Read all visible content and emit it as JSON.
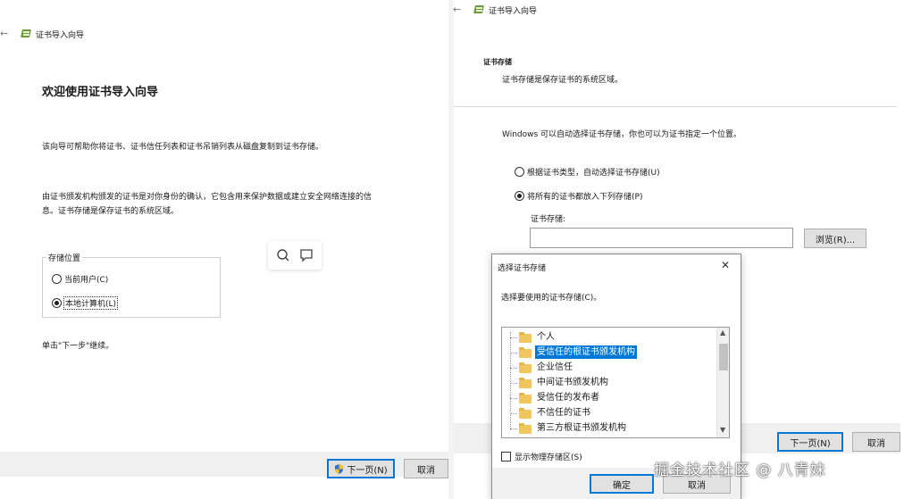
{
  "left_wizard": {
    "title": "证书导入向导",
    "heading": "欢迎使用证书导入向导",
    "intro": "该向导可帮助你将证书、证书信任列表和证书吊销列表从磁盘复制到证书存储。",
    "desc_line1": "由证书颁发机构颁发的证书是对你身份的确认，它包含用来保护数据或建立安全网络连接的信",
    "desc_line2": "息。证书存储是保存证书的系统区域。",
    "store_location_label": "存储位置",
    "option_current_user": "当前用户(C)",
    "option_local_machine": "本地计算机(L)",
    "continue_hint": "单击\"下一步\"继续。",
    "next_button": "下一页(N)",
    "cancel_button": "取消"
  },
  "right_wizard": {
    "title": "证书导入向导",
    "section_title": "证书存储",
    "section_desc": "证书存储是保存证书的系统区域。",
    "auto_hint": "Windows 可以自动选择证书存储，你也可以为证书指定一个位置。",
    "option_auto": "根据证书类型，自动选择证书存储(U)",
    "option_manual": "将所有的证书都放入下列存储(P)",
    "store_label": "证书存储:",
    "store_value": "",
    "browse_button": "浏览(R)...",
    "next_button": "下一页(N)",
    "cancel_button": "取消"
  },
  "dialog": {
    "title": "选择证书存储",
    "close_glyph": "✕",
    "prompt": "选择要使用的证书存储(C)。",
    "stores": [
      "个人",
      "受信任的根证书颁发机构",
      "企业信任",
      "中间证书颁发机构",
      "受信任的发布者",
      "不信任的证书",
      "第三方根证书颁发机构"
    ],
    "selected_index": 1,
    "show_physical": "显示物理存储区(S)",
    "ok_button": "确定",
    "cancel_button": "取消"
  },
  "watermark": "掘金技术社区 @ 八青妹",
  "colors": {
    "accent": "#0078d7",
    "folder": "#f0c75e",
    "button_bg": "#e1e1e1"
  }
}
